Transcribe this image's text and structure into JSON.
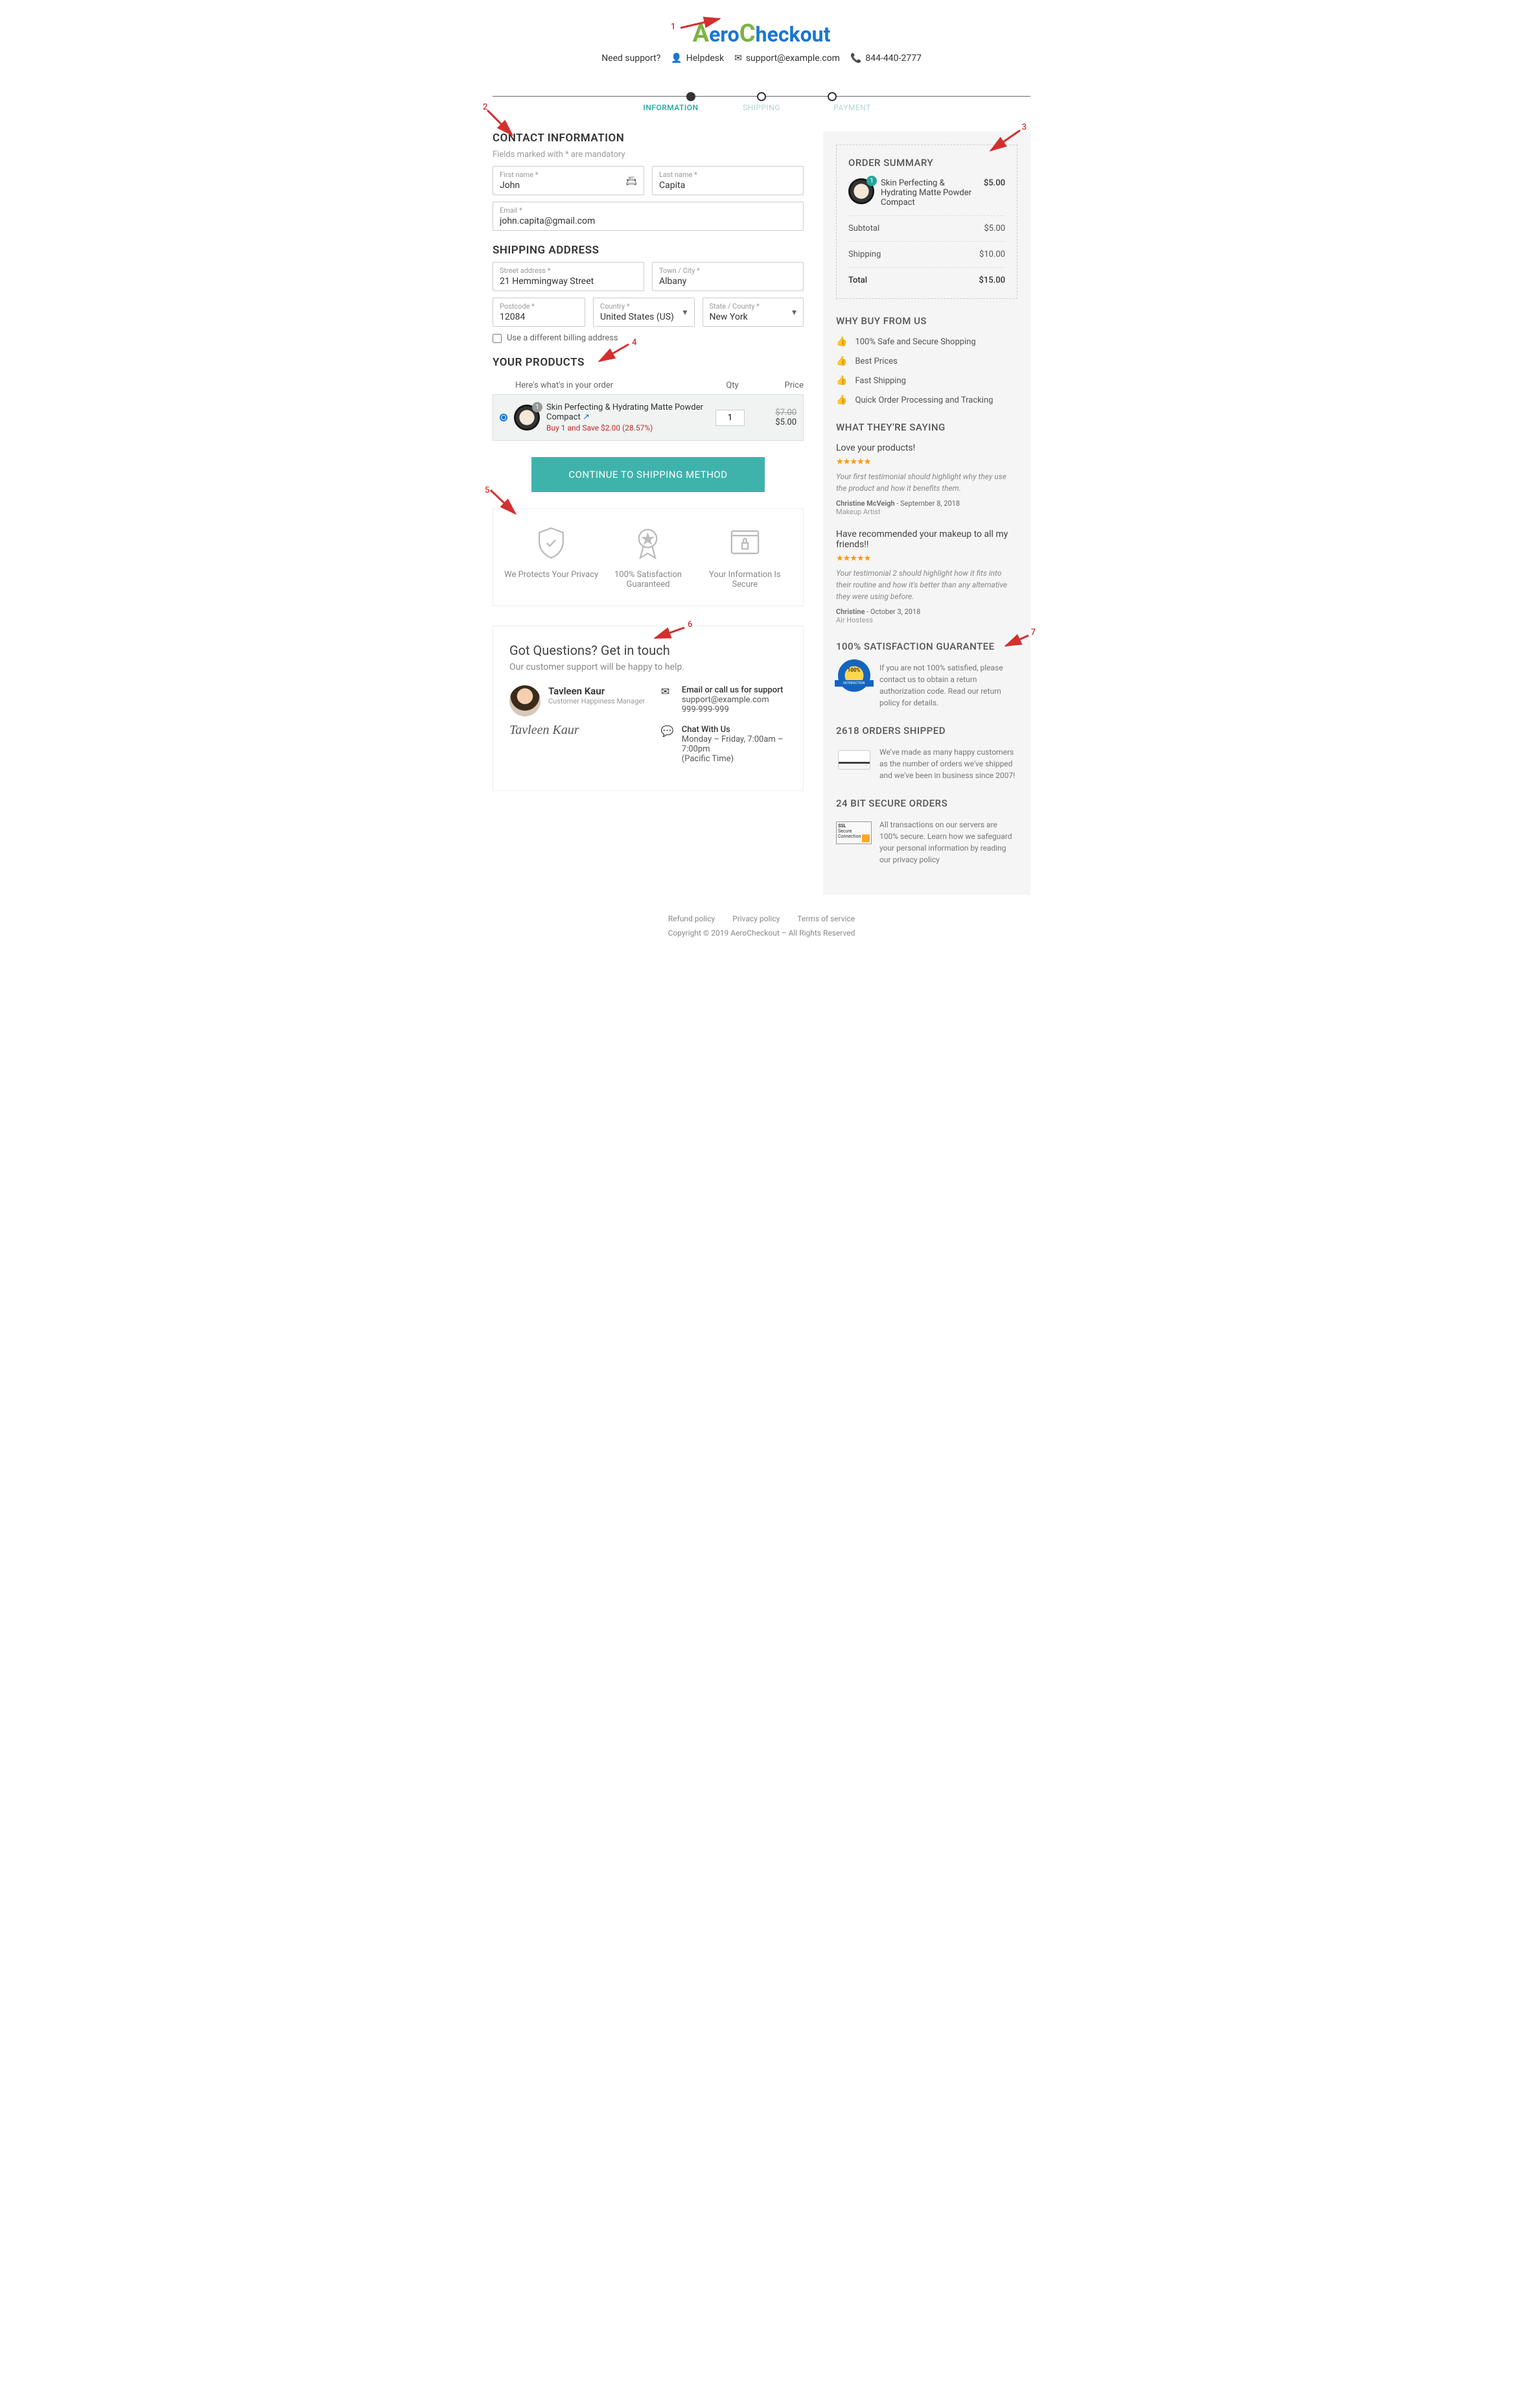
{
  "logo": {
    "text": "AeroCheckout"
  },
  "support": {
    "need": "Need support?",
    "helpdesk": "Helpdesk",
    "email": "support@example.com",
    "phone": "844-440-2777"
  },
  "steps": {
    "s1": "INFORMATION",
    "s2": "SHIPPING",
    "s3": "PAYMENT"
  },
  "contact": {
    "title": "CONTACT INFORMATION",
    "mandatory": "Fields marked with * are mandatory",
    "fname_label": "First name *",
    "fname": "John",
    "lname_label": "Last name *",
    "lname": "Capita",
    "email_label": "Email *",
    "email": "john.capita@gmail.com"
  },
  "shipping": {
    "title": "SHIPPING ADDRESS",
    "street_label": "Street address *",
    "street": "21 Hemmingway Street",
    "city_label": "Town / City *",
    "city": "Albany",
    "postcode_label": "Postcode *",
    "postcode": "12084",
    "country_label": "Country *",
    "country": "United States (US)",
    "state_label": "State / County *",
    "state": "New York",
    "diff_billing": "Use a different billing address"
  },
  "products": {
    "title": "YOUR PRODUCTS",
    "subtitle": "Here's what's in your order",
    "qty_h": "Qty",
    "price_h": "Price",
    "item": {
      "badge": "1",
      "name": "Skin Perfecting & Hydrating Matte Powder Compact",
      "discount": "Buy 1 and Save $2.00 (28.57%)",
      "qty": "1",
      "old_price": "$7.00",
      "price": "$5.00"
    },
    "continue": "CONTINUE TO SHIPPING METHOD"
  },
  "trust": {
    "t1": "We Protects Your Privacy",
    "t2": "100% Satisfaction Guaranteed",
    "t3": "Your Information Is Secure"
  },
  "questions": {
    "title": "Got Questions? Get in touch",
    "subtitle": "Our customer support will be happy to help.",
    "person_name": "Tavleen Kaur",
    "person_role": "Customer Happiness Manager",
    "signature": "Tavleen Kaur",
    "email_title": "Email or call us for support",
    "email": "support@example.com",
    "email_phone": "999-999-999",
    "chat_title": "Chat With Us",
    "chat_hours": "Monday – Friday, 7:00am – 7:00pm",
    "chat_tz": "(Pacific Time)"
  },
  "summary": {
    "title": "ORDER SUMMARY",
    "item_badge": "1",
    "item_name": "Skin Perfecting & Hydrating Matte Powder Compact",
    "item_price": "$5.00",
    "subtotal_l": "Subtotal",
    "subtotal": "$5.00",
    "shipping_l": "Shipping",
    "shipping": "$10.00",
    "total_l": "Total",
    "total": "$15.00"
  },
  "why_buy": {
    "title": "WHY BUY FROM US",
    "b1": "100% Safe and Secure Shopping",
    "b2": "Best Prices",
    "b3": "Fast Shipping",
    "b4": "Quick Order Processing and Tracking"
  },
  "testimonials": {
    "title": "WHAT THEY'RE SAYING",
    "t1": {
      "headline": "Love your products!",
      "quote": "Your first testimonial should highlight why they use the product and how it benefits them.",
      "author": "Christine McVeigh",
      "date": "September 8, 2018",
      "role": "Makeup Artist"
    },
    "t2": {
      "headline": "Have recommended your makeup to all my friends!!",
      "quote": "Your testimonial 2 should highlight how it fits into their routine and how it's better than any alternative they were using before.",
      "author": "Christine",
      "date": "October 3, 2018",
      "role": "Air Hostess"
    }
  },
  "guarantee": {
    "title": "100% SATISFACTION GUARANTEE",
    "text": "If you are not 100% satisfied, please contact us to obtain a return authorization code. Read our return policy for details."
  },
  "orders": {
    "title": "2618 ORDERS SHIPPED",
    "text": "We've made as many happy customers as the number of orders we've shipped and we've been in business since 2007!"
  },
  "secure": {
    "title": "24 BIT SECURE ORDERS",
    "ssl1": "SSL",
    "ssl2": "Secure",
    "ssl3": "Connection",
    "text": "All transactions on our servers are 100% secure. Learn how we safeguard your personal information by reading our privacy policy"
  },
  "footer": {
    "refund": "Refund policy",
    "privacy": "Privacy policy",
    "terms": "Terms of service",
    "copyright": "Copyright © 2019 AeroCheckout – All Rights Reserved"
  },
  "annotations": {
    "n1": "1",
    "n2": "2",
    "n3": "3",
    "n4": "4",
    "n5": "5",
    "n6": "6",
    "n7": "7"
  }
}
